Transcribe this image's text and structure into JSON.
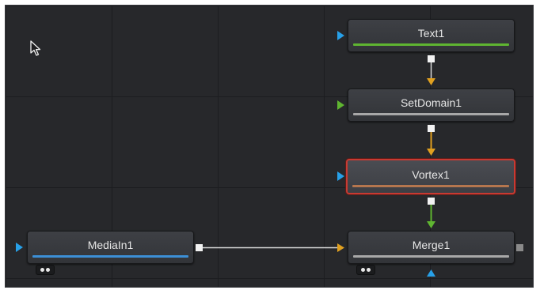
{
  "colors": {
    "canvas_background": "#27282b",
    "grid_line": "#1c1d20",
    "node_text": "#e6e6e6",
    "wire_gray": "#dcdcdc",
    "wire_orange": "#e0a020",
    "wire_green": "#5fb531",
    "input_blue": "#27a0e8",
    "input_green": "#5fb531",
    "input_orange": "#e0a020",
    "selected_border": "#c83a32"
  },
  "nodes": {
    "text1": {
      "label": "Text1",
      "bar_color": "#5fb531",
      "input_color": "#27a0e8"
    },
    "setdomain1": {
      "label": "SetDomain1",
      "bar_color": "#a8a8a8",
      "input_color": "#5fb531"
    },
    "vortex1": {
      "label": "Vortex1",
      "bar_color": "#b5764e",
      "input_color": "#27a0e8",
      "selected": true
    },
    "mediain1": {
      "label": "MediaIn1",
      "bar_color": "#3c8fd6",
      "input_color": "#27a0e8"
    },
    "merge1": {
      "label": "Merge1",
      "bar_color": "#a8a8a8",
      "input_color": "#e0a020",
      "mask_input_color": "#27a0e8"
    }
  },
  "icons": {
    "cursor": "mouse-pointer-icon",
    "view_badge": "view-toggle-icon"
  }
}
